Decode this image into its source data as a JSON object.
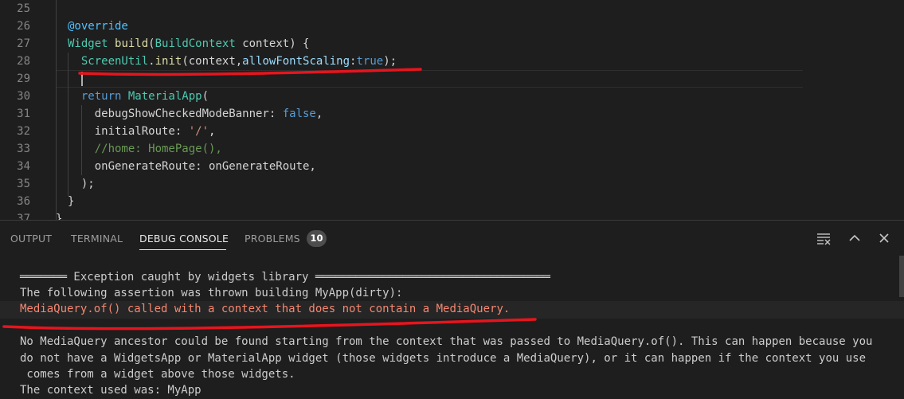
{
  "editor": {
    "lines": [
      {
        "number": "25",
        "tokens": []
      },
      {
        "number": "26",
        "tokens": [
          {
            "t": "@override",
            "c": "decorator"
          }
        ]
      },
      {
        "number": "27",
        "tokens": [
          {
            "t": "Widget ",
            "c": "type"
          },
          {
            "t": "build",
            "c": "func"
          },
          {
            "t": "(",
            "c": "plain"
          },
          {
            "t": "BuildContext",
            "c": "type"
          },
          {
            "t": " context) {",
            "c": "plain"
          }
        ]
      },
      {
        "number": "28",
        "tokens": [
          {
            "t": "  ScreenUtil",
            "c": "type"
          },
          {
            "t": ".",
            "c": "plain"
          },
          {
            "t": "init",
            "c": "func"
          },
          {
            "t": "(context,",
            "c": "plain"
          },
          {
            "t": "allowFontScaling",
            "c": "param"
          },
          {
            "t": ":",
            "c": "plain"
          },
          {
            "t": "true",
            "c": "keyword"
          },
          {
            "t": ");",
            "c": "plain"
          }
        ]
      },
      {
        "number": "29",
        "tokens": []
      },
      {
        "number": "30",
        "tokens": [
          {
            "t": "  return ",
            "c": "keyword"
          },
          {
            "t": "MaterialApp",
            "c": "type"
          },
          {
            "t": "(",
            "c": "plain"
          }
        ]
      },
      {
        "number": "31",
        "tokens": [
          {
            "t": "    debugShowCheckedModeBanner: ",
            "c": "plain"
          },
          {
            "t": "false",
            "c": "keyword"
          },
          {
            "t": ",",
            "c": "plain"
          }
        ]
      },
      {
        "number": "32",
        "tokens": [
          {
            "t": "    initialRoute: ",
            "c": "plain"
          },
          {
            "t": "'/'",
            "c": "string"
          },
          {
            "t": ",",
            "c": "plain"
          }
        ]
      },
      {
        "number": "33",
        "tokens": [
          {
            "t": "    //home: HomePage(),",
            "c": "comment"
          }
        ]
      },
      {
        "number": "34",
        "tokens": [
          {
            "t": "    onGenerateRoute: onGenerateRoute,",
            "c": "plain"
          }
        ]
      },
      {
        "number": "35",
        "tokens": [
          {
            "t": "  );",
            "c": "plain"
          }
        ]
      },
      {
        "number": "36",
        "tokens": [
          {
            "t": "}",
            "c": "plain"
          }
        ]
      },
      {
        "number": "37",
        "tokens": [
          {
            "t": "}",
            "c": "plain"
          }
        ]
      }
    ]
  },
  "panel": {
    "tabs": [
      {
        "label": "OUTPUT",
        "active": false
      },
      {
        "label": "TERMINAL",
        "active": false
      },
      {
        "label": "DEBUG CONSOLE",
        "active": true
      },
      {
        "label": "PROBLEMS",
        "active": false
      }
    ],
    "problems_count": "10",
    "icons": [
      "clear-console-icon",
      "maximize-panel-icon",
      "close-panel-icon"
    ]
  },
  "console": {
    "header": "═══════ Exception caught by widgets library ═══════════════════════════════════",
    "assertion": "The following assertion was thrown building MyApp(dirty):",
    "error": "MediaQuery.of() called with a context that does not contain a MediaQuery.",
    "detail": [
      "No MediaQuery ancestor could be found starting from the context that was passed to MediaQuery.of(). This can happen because you",
      "do not have a WidgetsApp or MaterialApp widget (those widgets introduce a MediaQuery), or it can happen if the context you use",
      " comes from a widget above those widgets."
    ],
    "cutoff": "The context used was: MyApp"
  },
  "colors": {
    "background": "#1e1e1e",
    "error_text": "#f48771",
    "annotation": "#e8141d",
    "badge": "#4d4d4d"
  }
}
